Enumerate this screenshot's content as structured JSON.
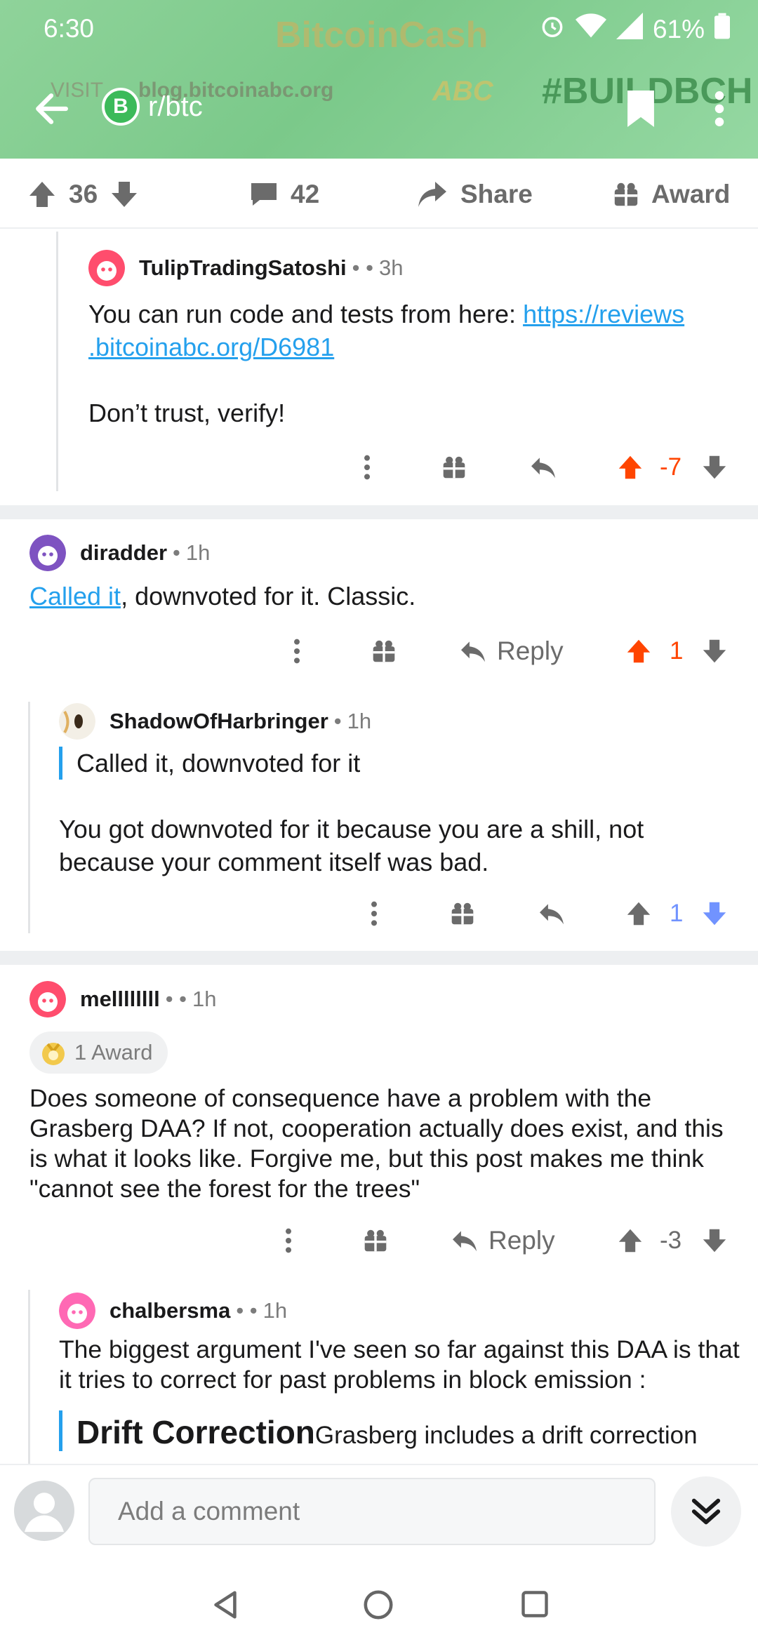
{
  "status": {
    "time": "6:30",
    "battery": "61%"
  },
  "banner": {
    "bg_brand": "BitcoinCash",
    "bg_visit": "VISIT",
    "bg_url": "blog.bitcoinabc.org",
    "bg_tag": "#BUILDBCH",
    "bg_abc": "ABC"
  },
  "header": {
    "subreddit": "r/btc",
    "coin_symbol": "B"
  },
  "post_actions": {
    "votes": "36",
    "comments": "42",
    "share": "Share",
    "award": "Award"
  },
  "comments": [
    {
      "user": "TulipTradingSatoshi",
      "sep": "• •",
      "age": "3h",
      "link_text": "https://reviews.bitcoinabc.org/D6981",
      "link_line1": "https://reviews",
      "link_line2": ".bitcoinabc.org/D6981",
      "text_before": "You can run code and tests from here:",
      "text_after": "Don’t trust, verify!",
      "score": "-7"
    },
    {
      "user": "diradder",
      "sep": "•",
      "age": "1h",
      "link_text": "Called it",
      "text": ", downvoted for it. Classic.",
      "reply": "Reply",
      "score": "1"
    },
    {
      "user": "ShadowOfHarbringer",
      "sep": "•",
      "age": "1h",
      "quote": "Called it, downvoted for it",
      "text": "You got downvoted for it because you are a shill, not because your comment itself was bad.",
      "score": "1"
    },
    {
      "user": "mellllllll",
      "sep": "• •",
      "age": "1h",
      "award": "1 Award",
      "text": "Does someone of consequence have a problem with the Grasberg DAA? If not, cooperation actually does exist, and this is what it looks like. Forgive me, but this post makes me think \"cannot see the forest for the trees\"",
      "reply": "Reply",
      "score": "-3"
    },
    {
      "user": "chalbersma",
      "sep": "• •",
      "age": "1h",
      "text": "The biggest argument I've seen so far against this DAA is that it tries to correct for past problems in block emission :",
      "quote_heading": "Drift Correction",
      "quote_text": "Grasberg includes a drift correction"
    }
  ],
  "composer": {
    "placeholder": "Add a comment"
  },
  "colors": {
    "upvote": "#ff4500",
    "downvote": "#7193ff",
    "link": "#24a0ed",
    "banner": "#8fd39a"
  }
}
